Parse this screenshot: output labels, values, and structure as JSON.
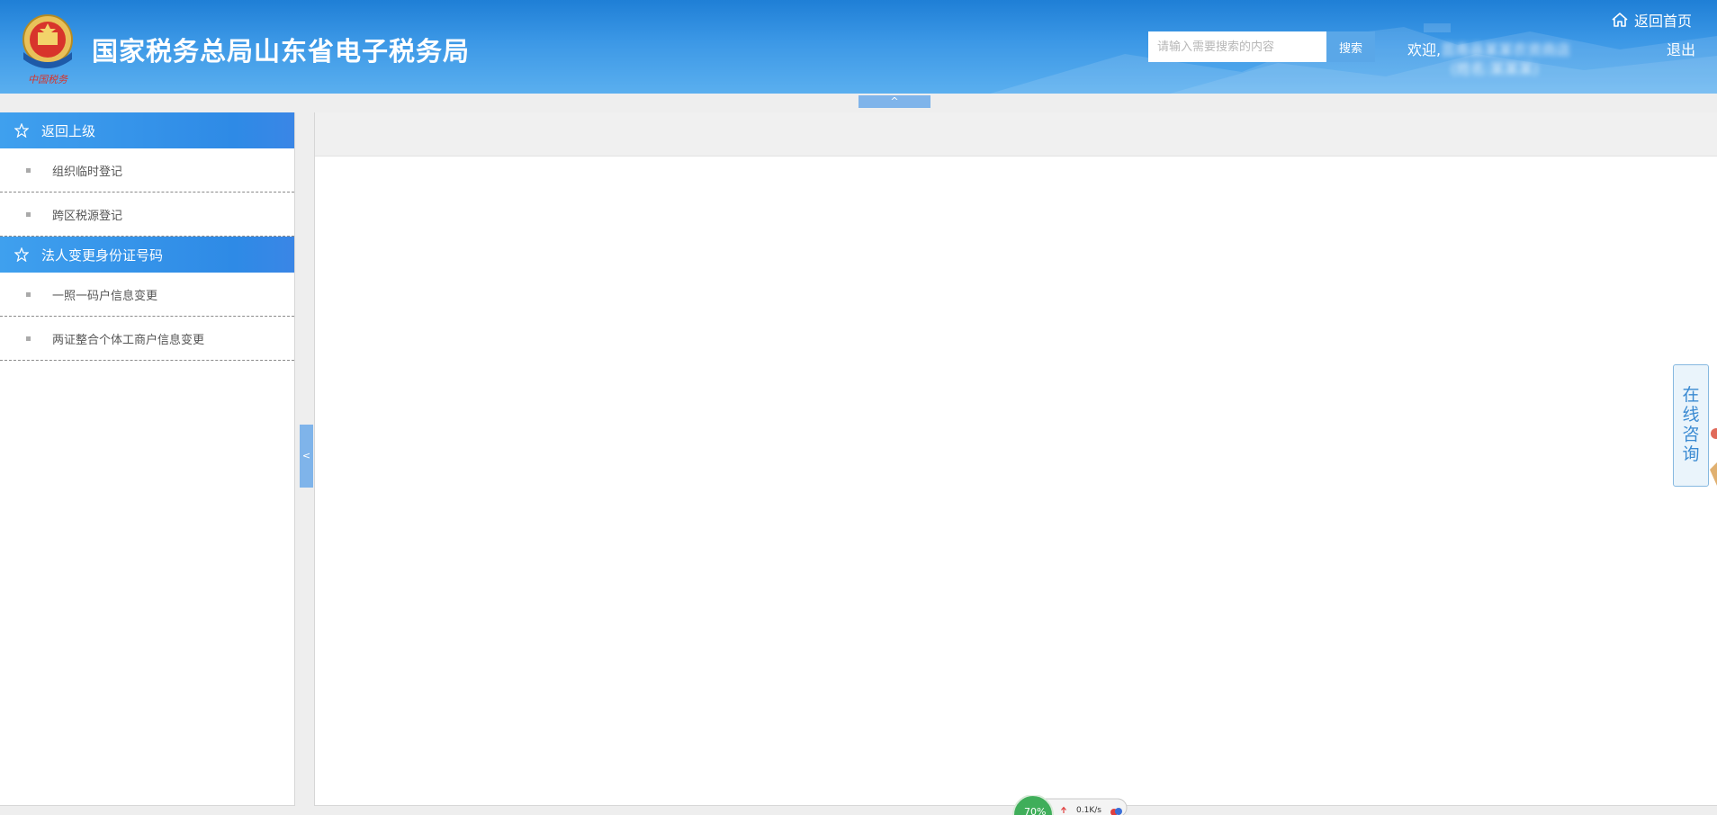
{
  "header": {
    "title": "国家税务总局山东省电子税务局",
    "search_placeholder": "请输入需要搜索的内容",
    "search_button": "搜索",
    "home_link": "返回首页",
    "welcome_prefix": "欢迎,",
    "company_name": "莒南县某某农资商店",
    "name_line": "(姓名:某某某)",
    "logout": "退出",
    "colors": {
      "header_top": "#1f7fd6",
      "header_bottom": "#5aafef",
      "title_text": "#ffffff"
    }
  },
  "collapse_top_label": "^",
  "collapse_left_label": "<",
  "sidebar": {
    "sections": [
      {
        "label": "返回上级",
        "icon": "star-outline-icon",
        "items": [
          {
            "label": "组织临时登记"
          },
          {
            "label": "跨区税源登记"
          }
        ]
      },
      {
        "label": "法人变更身份证号码",
        "icon": "star-outline-icon",
        "items": [
          {
            "label": "一照一码户信息变更"
          },
          {
            "label": "两证整合个体工商户信息变更"
          }
        ]
      }
    ],
    "colors": {
      "section_bg": "#2e8ae6"
    }
  },
  "consult": {
    "chars": [
      "在",
      "线",
      "咨",
      "询"
    ]
  },
  "net_widget": {
    "percent": "70%",
    "speed": "0.1K/s"
  }
}
